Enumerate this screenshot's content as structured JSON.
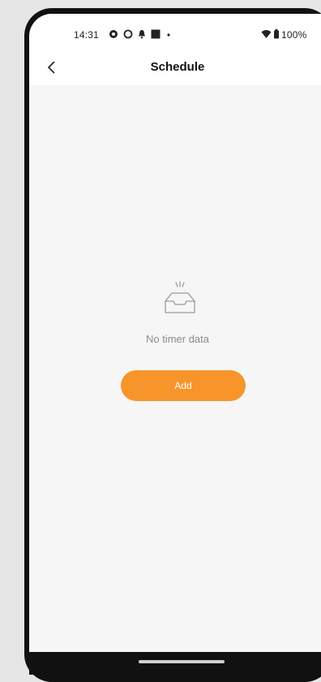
{
  "status_bar": {
    "time": "14:31",
    "battery_text": "100%",
    "icons": [
      "settings-icon",
      "sync-icon",
      "notification-bell-icon",
      "media-icon",
      "dot-icon",
      "wifi-icon",
      "battery-icon"
    ]
  },
  "header": {
    "title": "Schedule",
    "back_icon": "chevron-left-icon"
  },
  "empty_state": {
    "icon": "empty-inbox-icon",
    "message": "No timer data",
    "button_label": "Add"
  },
  "colors": {
    "accent": "#f7952b",
    "background": "#f6f6f6",
    "muted_text": "#8c8c8c"
  }
}
